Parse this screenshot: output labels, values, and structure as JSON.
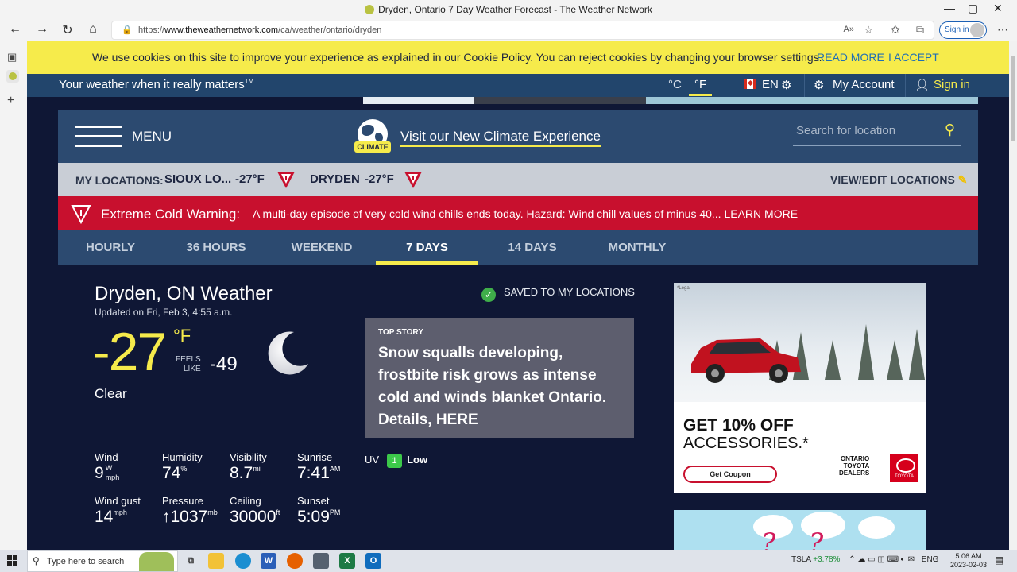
{
  "window": {
    "title": "Dryden, Ontario 7 Day Weather Forecast - The Weather Network"
  },
  "browser": {
    "url_prefix": "https://",
    "url_host": "www.theweathernetwork.com",
    "url_path": "/ca/weather/ontario/dryden",
    "signin_label": "Sign in"
  },
  "cookie": {
    "message": "We use cookies on this site to improve your experience as explained in our Cookie Policy. You can reject cookies by changing your browser settings.",
    "read_more": "READ MORE",
    "accept": "I ACCEPT"
  },
  "topbar": {
    "tagline": "Your weather when it really matters",
    "tagline_tm": "TM",
    "unit_c": "°C",
    "unit_f": "°F",
    "language": "EN",
    "account": "My Account",
    "signin": "Sign in"
  },
  "header": {
    "menu_label": "MENU",
    "climate_badge": "CLIMATE",
    "climate_link": "Visit our New Climate Experience",
    "search_placeholder": "Search for location"
  },
  "locations": {
    "label": "MY LOCATIONS:",
    "items": [
      {
        "name": "SIOUX LO...",
        "temp": "-27°F"
      },
      {
        "name": "DRYDEN",
        "temp": "-27°F"
      }
    ],
    "edit": "VIEW/EDIT LOCATIONS"
  },
  "alert": {
    "title": "Extreme Cold Warning:",
    "text": "A multi-day episode of very cold wind chills ends today. Hazard: Wind chill values of minus 40... LEARN MORE"
  },
  "tabs": [
    "HOURLY",
    "36 HOURS",
    "WEEKEND",
    "7 DAYS",
    "14 DAYS",
    "MONTHLY"
  ],
  "active_tab": "7 DAYS",
  "current": {
    "city": "Dryden, ON Weather",
    "updated": "Updated on Fri, Feb 3, 4:55 a.m.",
    "temp": "-27",
    "temp_unit": "°F",
    "feels_label_1": "FEELS",
    "feels_label_2": "LIKE",
    "feels_value": "-49",
    "condition": "Clear",
    "saved": "SAVED TO MY LOCATIONS"
  },
  "stats": {
    "wind": {
      "label": "Wind",
      "value": "9",
      "dir": "W",
      "unit": "mph"
    },
    "humidity": {
      "label": "Humidity",
      "value": "74",
      "unit": "%"
    },
    "visibility": {
      "label": "Visibility",
      "value": "8.7",
      "unit": "mi"
    },
    "sunrise": {
      "label": "Sunrise",
      "value": "7:41",
      "unit": "AM"
    },
    "wind_gust": {
      "label": "Wind gust",
      "value": "14",
      "unit": "mph"
    },
    "pressure": {
      "label": "Pressure",
      "arrow": "↑",
      "value": "1037",
      "unit": "mb"
    },
    "ceiling": {
      "label": "Ceiling",
      "value": "30000",
      "unit": "ft"
    },
    "sunset": {
      "label": "Sunset",
      "value": "5:09",
      "unit": "PM"
    }
  },
  "uv": {
    "label": "UV",
    "value": "1",
    "level": "Low"
  },
  "story": {
    "kicker": "TOP STORY",
    "headline": "Snow squalls developing, frostbite risk grows as intense cold and winds blanket Ontario. Details, HERE"
  },
  "ad1": {
    "legal": "*Legal",
    "line1": "GET 10% OFF",
    "line2": "ACCESSORIES.*",
    "cta": "Get Coupon",
    "dealer_1": "ONTARIO",
    "dealer_2": "TOYOTA",
    "dealer_3": "DEALERS",
    "brand": "TOYOTA"
  },
  "taskbar": {
    "search_placeholder": "Type here to search",
    "ticker": "TSLA",
    "ticker_change": "+3.78%",
    "lang": "ENG",
    "time": "5:06 AM",
    "date": "2023-02-03"
  },
  "colors": {
    "brand_yellow": "#f6eb4b",
    "navy": "#22456c",
    "alert_red": "#c8102e"
  }
}
